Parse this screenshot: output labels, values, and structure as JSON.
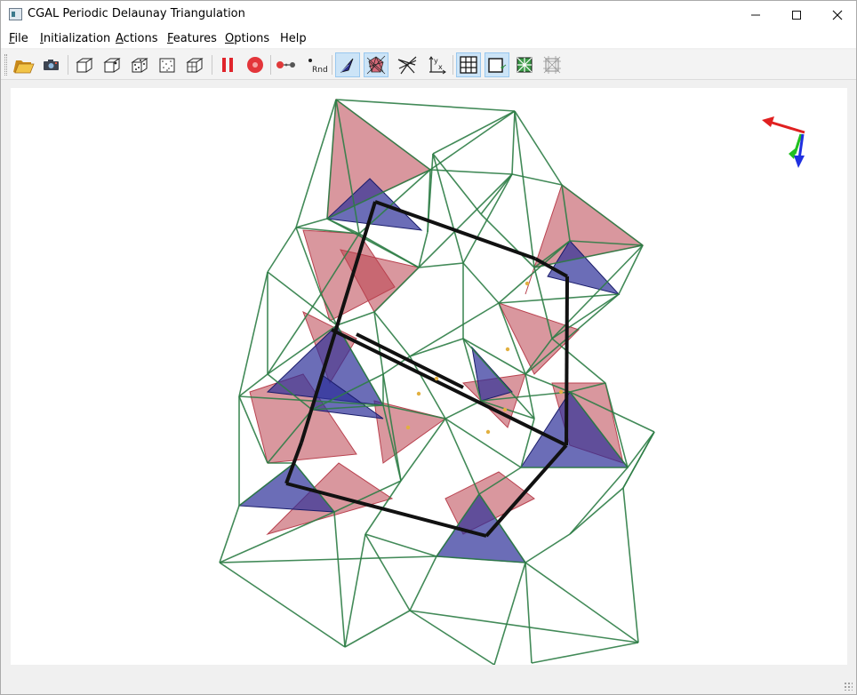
{
  "window": {
    "title": "CGAL Periodic Delaunay Triangulation",
    "controls": {
      "minimize": "—",
      "maximize": "☐",
      "close": "✕"
    }
  },
  "menu": {
    "file": {
      "accel": "F",
      "rest": "ile"
    },
    "initialization": {
      "accel": "I",
      "rest": "nitialization"
    },
    "actions": {
      "accel": "A",
      "rest": "ctions"
    },
    "features": {
      "accel": "F",
      "rest": "eatures"
    },
    "options": {
      "accel": "O",
      "rest": "ptions"
    },
    "help": {
      "accel": "",
      "rest": "Help"
    }
  },
  "toolbar": {
    "items": [
      {
        "icon": "open-folder-icon",
        "active": false
      },
      {
        "icon": "screenshot-camera-icon",
        "active": false
      },
      {
        "icon": "single-cube-icon",
        "active": false
      },
      {
        "icon": "cube-point-icon",
        "active": false
      },
      {
        "icon": "cube-dotted-icon",
        "active": false
      },
      {
        "icon": "random-points-square-icon",
        "active": false
      },
      {
        "icon": "cube-grid-icon",
        "active": false
      },
      {
        "icon": "pause-icon",
        "active": false
      },
      {
        "icon": "record-icon",
        "active": false
      },
      {
        "icon": "step-points-icon",
        "active": false
      },
      {
        "icon": "random-point-icon",
        "active": false
      },
      {
        "icon": "pointer-triangle-icon",
        "active": true
      },
      {
        "icon": "conflict-region-icon",
        "active": true
      },
      {
        "icon": "delaunay-star-icon",
        "active": false
      },
      {
        "icon": "axes-xy-icon",
        "active": false
      },
      {
        "icon": "grid-icon",
        "active": true
      },
      {
        "icon": "cut-box-icon",
        "active": true
      },
      {
        "icon": "tiles-icon",
        "active": false
      },
      {
        "icon": "periodic-copies-icon",
        "active": false
      }
    ],
    "labels": {
      "rnd": "Rnd",
      "x": "x",
      "y": "y"
    }
  },
  "colors": {
    "edges": "#2e7d46",
    "red_tet": "#b9424f",
    "blue_tet": "#2c2f99",
    "domain": "#111111",
    "highlight_point": "#e2b040",
    "axis_x": "#e02020",
    "axis_y": "#20c020",
    "axis_z": "#2030e0"
  }
}
